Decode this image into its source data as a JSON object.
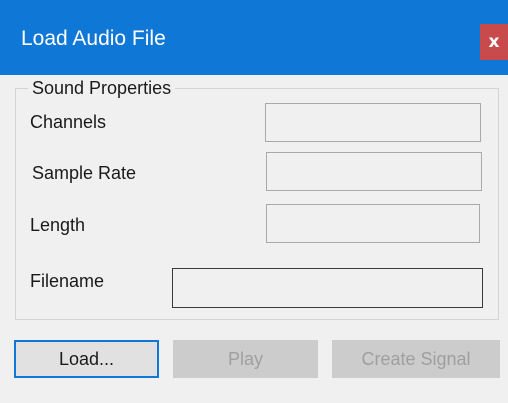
{
  "window": {
    "title": "Load Audio File",
    "close_label": "x"
  },
  "sound_properties": {
    "group_label": "Sound Properties",
    "channels_label": "Channels",
    "channels_value": "",
    "sample_rate_label": "Sample Rate",
    "sample_rate_value": "",
    "length_label": "Length",
    "length_value": ""
  },
  "filename": {
    "label": "Filename",
    "value": ""
  },
  "buttons": {
    "load_label": "Load...",
    "play_label": "Play",
    "create_signal_label": "Create Signal"
  },
  "colors": {
    "titlebar": "#0f78d7",
    "close_button": "#c84a4a",
    "focus_border": "#0f78d7",
    "disabled_text": "#9f9f9f"
  }
}
